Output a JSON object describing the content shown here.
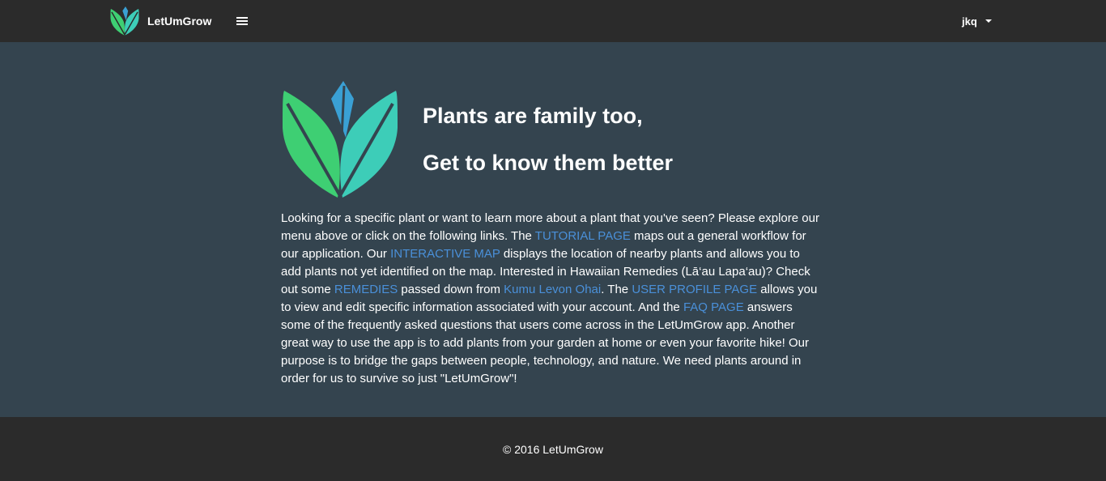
{
  "navbar": {
    "brand_name": "LetUmGrow",
    "logo_icon": "lotus-leaf-logo-icon",
    "menu_icon": "hamburger-menu-icon",
    "user_name": "jkq",
    "caret_icon": "caret-down-icon"
  },
  "hero": {
    "headline_1": "Plants are family too,",
    "headline_2": "Get to know them better"
  },
  "intro": {
    "t1": "Looking for a specific plant or want to learn more about a plant that you've seen? Please explore our menu above or click on the following links. The ",
    "link_tutorial": "TUTORIAL PAGE",
    "t2": " maps out a general workflow for our application. Our ",
    "link_map": "INTERACTIVE MAP",
    "t3": " displays the location of nearby plants and allows you to add plants not yet identified on the map. Interested in Hawaiian Remedies (Lā‘au Lapa‘au)? Check out some ",
    "link_remedies": "REMEDIES",
    "t4": " passed down from ",
    "link_kumu": "Kumu Levon Ohai",
    "t5": ". The ",
    "link_profile": "USER PROFILE PAGE",
    "t6": " allows you to view and edit specific information associated with your account. And the ",
    "link_faq": "FAQ PAGE",
    "t7": " answers some of the frequently asked questions that users come across in the LetUmGrow app. Another great way to use the app is to add plants from your garden at home or even your favorite hike! Our purpose is to bridge the gaps between people, technology, and nature. We need plants around in order for us to survive so just \"LetUmGrow\"!"
  },
  "footer": {
    "copyright": "© 2016 LetUmGrow"
  },
  "colors": {
    "navbar_bg": "#2b2b2b",
    "page_bg": "#34444f",
    "link": "#4a90d9",
    "leaf_green": "#3ecf73",
    "leaf_teal": "#3dcdb8",
    "leaf_blue": "#3aa0d4"
  }
}
